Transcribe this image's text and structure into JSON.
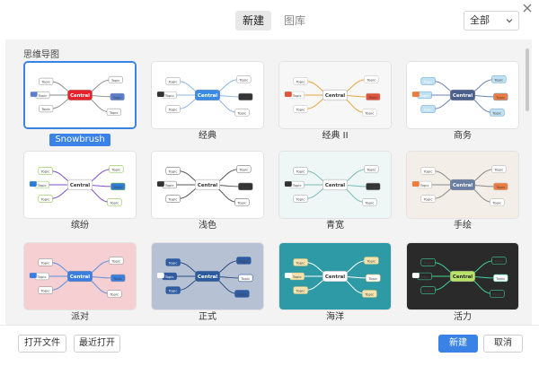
{
  "header": {
    "tabs": [
      {
        "label": "新建",
        "active": true
      },
      {
        "label": "图库",
        "active": false
      }
    ],
    "filter_value": "全部",
    "close_icon": "close-icon"
  },
  "section": {
    "title": "思维导图"
  },
  "templates": [
    {
      "label": "Snowbrush",
      "selected": true,
      "style": "snowbrush"
    },
    {
      "label": "经典",
      "selected": false,
      "style": "classic"
    },
    {
      "label": "经典 II",
      "selected": false,
      "style": "classic2"
    },
    {
      "label": "商务",
      "selected": false,
      "style": "business"
    },
    {
      "label": "缤纷",
      "selected": false,
      "style": "colorful"
    },
    {
      "label": "浅色",
      "selected": false,
      "style": "light"
    },
    {
      "label": "青宽",
      "selected": false,
      "style": "cyan"
    },
    {
      "label": "手绘",
      "selected": false,
      "style": "hand"
    },
    {
      "label": "派对",
      "selected": false,
      "style": "party"
    },
    {
      "label": "正式",
      "selected": false,
      "style": "formal"
    },
    {
      "label": "海洋",
      "selected": false,
      "style": "ocean"
    },
    {
      "label": "活力",
      "selected": false,
      "style": "vital"
    }
  ],
  "footer": {
    "open_file": "打开文件",
    "recent": "最近打开",
    "create": "新建",
    "cancel": "取消"
  },
  "colors": {
    "accent": "#3a82e6",
    "central_snowbrush": "#e8202a",
    "central_classic": "#3a8be6",
    "central_business": "#4a5f8c",
    "central_formal": "#2c5aa0",
    "central_vital": "#b8e26a",
    "ocean_bg": "#2d9aa6",
    "vital_bg": "#2a2a2a",
    "party_bg": "#f6cfd2",
    "formal_bg": "#b6c1d4"
  },
  "mindmap": {
    "central": "Central",
    "topic": "Topic"
  }
}
